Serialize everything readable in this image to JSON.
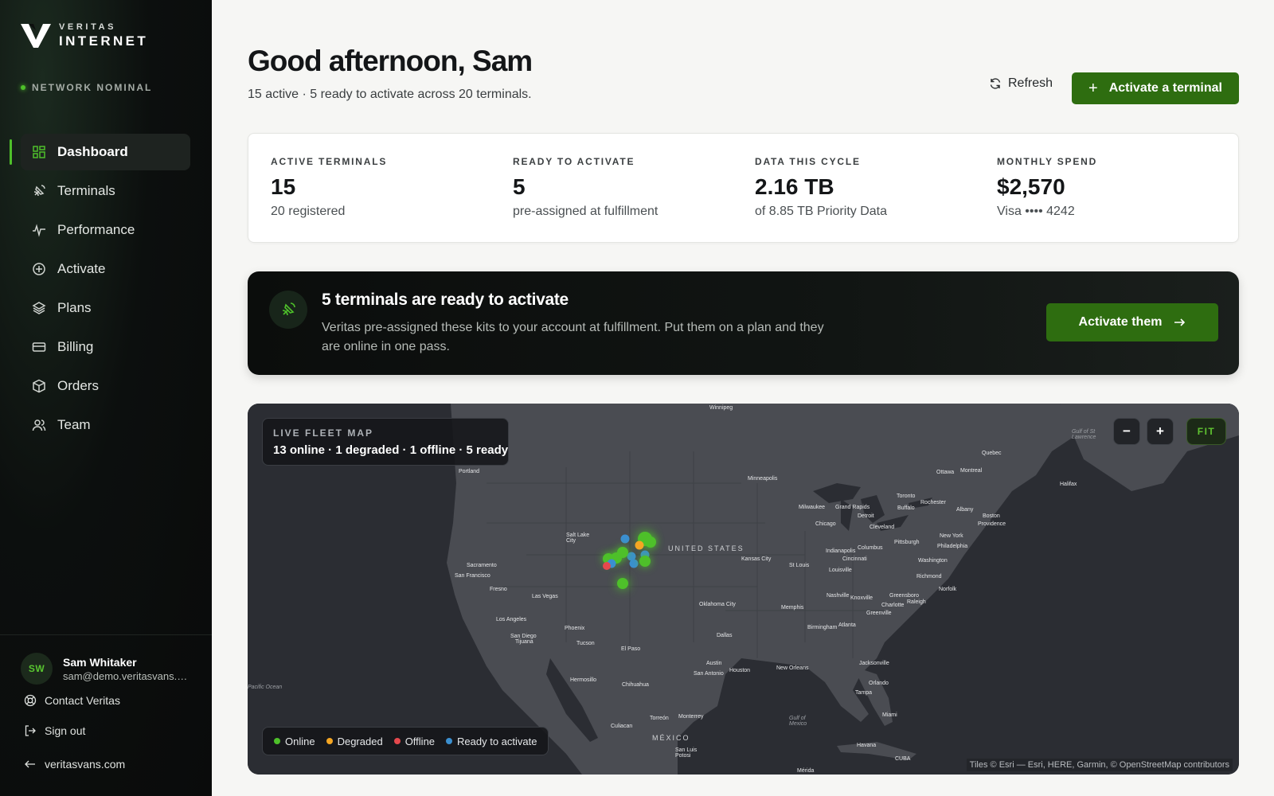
{
  "brand": {
    "top": "VERITAS",
    "bottom": "INTERNET"
  },
  "network_status": "NETWORK NOMINAL",
  "nav": [
    {
      "label": "Dashboard",
      "icon": "grid-icon",
      "active": true
    },
    {
      "label": "Terminals",
      "icon": "satellite-icon"
    },
    {
      "label": "Performance",
      "icon": "activity-icon"
    },
    {
      "label": "Activate",
      "icon": "plus-circle-icon"
    },
    {
      "label": "Plans",
      "icon": "layers-icon"
    },
    {
      "label": "Billing",
      "icon": "credit-card-icon"
    },
    {
      "label": "Orders",
      "icon": "package-icon"
    },
    {
      "label": "Team",
      "icon": "users-icon"
    }
  ],
  "user": {
    "initials": "SW",
    "name": "Sam Whitaker",
    "email": "sam@demo.veritasvans.com"
  },
  "footer_links": {
    "contact": "Contact Veritas",
    "signout": "Sign out",
    "site": "veritasvans.com"
  },
  "header": {
    "title": "Good afternoon, Sam",
    "subtitle": "15 active · 5 ready to activate across 20 terminals.",
    "refresh": "Refresh",
    "activate": "Activate a terminal"
  },
  "stats": [
    {
      "label": "ACTIVE TERMINALS",
      "value": "15",
      "sub": "20 registered"
    },
    {
      "label": "READY TO ACTIVATE",
      "value": "5",
      "sub": "pre-assigned at fulfillment"
    },
    {
      "label": "DATA THIS CYCLE",
      "value": "2.16 TB",
      "sub": "of 8.85 TB Priority Data"
    },
    {
      "label": "MONTHLY SPEND",
      "value": "$2,570",
      "sub": "Visa •••• 4242"
    }
  ],
  "banner": {
    "title": "5 terminals are ready to activate",
    "text": "Veritas pre-assigned these kits to your account at fulfillment. Put them on a plan and they are online in one pass.",
    "button": "Activate them"
  },
  "map": {
    "card_label": "LIVE FLEET MAP",
    "card_value": "13 online · 1 degraded · 1 offline · 5 ready",
    "zoom_out": "−",
    "zoom_in": "+",
    "fit": "FIT",
    "legend": [
      {
        "label": "Online",
        "color": "#4ec02a"
      },
      {
        "label": "Degraded",
        "color": "#f5a623"
      },
      {
        "label": "Offline",
        "color": "#e5484d"
      },
      {
        "label": "Ready to activate",
        "color": "#3b8fd0"
      }
    ],
    "attribution": "Tiles © Esri — Esri, HERE, Garmin, © OpenStreetMap contributors",
    "places": {
      "winnipeg": "Winnipeg",
      "portland": "Portland",
      "minneapolis": "Minneapolis",
      "ottawa": "Ottawa",
      "montreal": "Montreal",
      "quebec": "Quebec",
      "halifax": "Halifax",
      "toronto": "Toronto",
      "rochester": "Rochester",
      "buffalo": "Buffalo",
      "albany": "Albany",
      "boston": "Boston",
      "providence": "Providence",
      "milwaukee": "Milwaukee",
      "grand_rapids": "Grand Rapids",
      "detroit": "Detroit",
      "chicago": "Chicago",
      "cleveland": "Cleveland",
      "pittsburgh": "Pittsburgh",
      "new_york": "New York",
      "philadelphia": "Philadelphia",
      "washington": "Washington",
      "richmond": "Richmond",
      "norfolk": "Norfolk",
      "salt_lake": "Salt Lake City",
      "united_states": "UNITED STATES",
      "kansas_city": "Kansas City",
      "st_louis": "St Louis",
      "indianapolis": "Indianapolis",
      "columbus": "Columbus",
      "cincinnati": "Cincinnati",
      "louisville": "Louisville",
      "sacramento": "Sacramento",
      "san_francisco": "San Francisco",
      "fresno": "Fresno",
      "las_vegas": "Las Vegas",
      "los_angeles": "Los Angeles",
      "san_diego": "San Diego",
      "tijuana": "Tijuana",
      "phoenix": "Phoenix",
      "tucson": "Tucson",
      "el_paso": "El Paso",
      "oklahoma_city": "Oklahoma City",
      "memphis": "Memphis",
      "nashville": "Nashville",
      "knoxville": "Knoxville",
      "greensboro": "Greensboro",
      "raleigh": "Raleigh",
      "charlotte": "Charlotte",
      "greenville": "Greenville",
      "birmingham": "Birmingham",
      "atlanta": "Atlanta",
      "dallas": "Dallas",
      "austin": "Austin",
      "san_antonio": "San Antonio",
      "houston": "Houston",
      "new_orleans": "New Orleans",
      "jacksonville": "Jacksonville",
      "orlando": "Orlando",
      "tampa": "Tampa",
      "miami": "Miami",
      "hermosillo": "Hermosillo",
      "chihuahua": "Chihuahua",
      "culiacan": "Culiacan",
      "torreon": "Torreón",
      "monterrey": "Monterrey",
      "mexico": "MÉXICO",
      "san_luis_potosi": "San Luis Potosi",
      "havana": "Havana",
      "cuba": "CUBA",
      "merida": "Mérida",
      "pacific": "Pacific Ocean",
      "gulf_mexico": "Gulf of Mexico",
      "gulf_st_lawrence": "Gulf of St Lawrence"
    }
  },
  "colors": {
    "accent": "#2e6d10",
    "online": "#4ec02a",
    "degraded": "#f5a623",
    "offline": "#e5484d",
    "ready": "#3b8fd0"
  }
}
